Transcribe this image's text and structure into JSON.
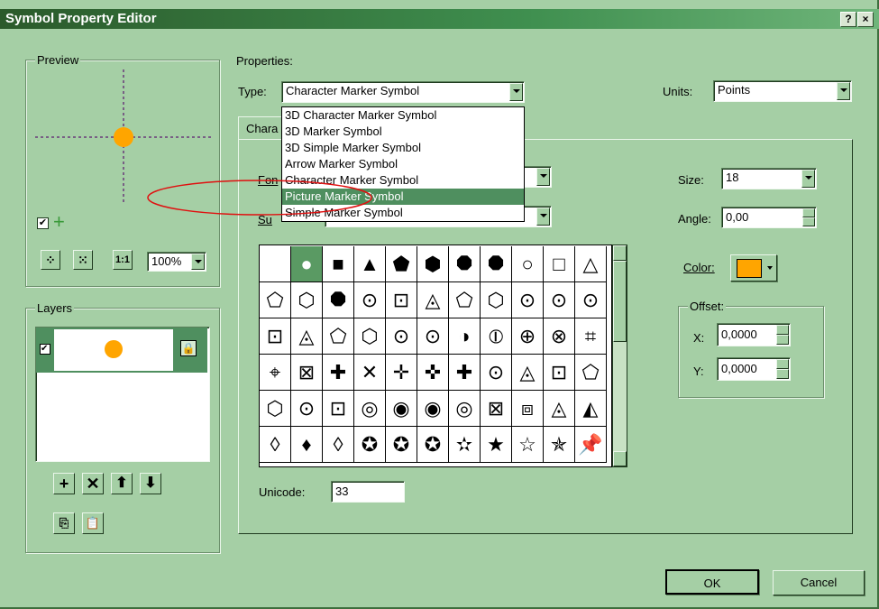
{
  "window": {
    "title": "Symbol Property Editor",
    "help_label": "?",
    "close_label": "×"
  },
  "preview": {
    "label": "Preview",
    "zoom_value": "100%",
    "marker_color": "#FFA500"
  },
  "layers": {
    "label": "Layers"
  },
  "properties": {
    "label": "Properties:",
    "type_label": "Type:",
    "type_value": "Character Marker Symbol",
    "units_label": "Units:",
    "units_value": "Points",
    "tab_label": "Chara",
    "font_label": "Fon",
    "subset_label": "Su",
    "type_options": [
      "3D Character Marker Symbol",
      "3D Marker Symbol",
      "3D Simple Marker Symbol",
      "Arrow Marker Symbol",
      "Character Marker Symbol",
      "Picture Marker Symbol",
      "Simple Marker Symbol"
    ],
    "highlighted_option": "Picture Marker Symbol",
    "size_label": "Size:",
    "size_value": "18",
    "angle_label": "Angle:",
    "angle_value": "0,00",
    "color_label": "Color:",
    "color_value": "#FFA500",
    "offset_label": "Offset:",
    "x_label": "X:",
    "x_value": "0,0000",
    "y_label": "Y:",
    "y_value": "0,0000",
    "unicode_label": "Unicode:",
    "unicode_value": "33",
    "glyphs": [
      [
        "",
        "●",
        "■",
        "▲",
        "⬟",
        "⬢",
        "⯃",
        "⯃",
        "○",
        "□",
        "△"
      ],
      [
        "⬠",
        "⬡",
        "⯃",
        "⊙",
        "⊡",
        "◬",
        "⬠",
        "⬡",
        "⊙",
        "⊙",
        "⊙"
      ],
      [
        "⊡",
        "◬",
        "⬠",
        "⬡",
        "⊙",
        "⊙",
        "◑",
        "⦶",
        "⊕",
        "⊗",
        "⌗"
      ],
      [
        "⌖",
        "⊠",
        "✚",
        "✕",
        "✛",
        "✜",
        "✚",
        "⊙",
        "◬",
        "⊡",
        "⬠"
      ],
      [
        "⬡",
        "⊙",
        "⊡",
        "◎",
        "◉",
        "◉",
        "◎",
        "⊠",
        "⧈",
        "◬",
        "◭"
      ],
      [
        "◊",
        "♦",
        "◊",
        "✪",
        "✪",
        "✪",
        "✫",
        "★",
        "☆",
        "✯",
        "📌"
      ]
    ],
    "selected_glyph_index": "1"
  },
  "buttons": {
    "ok": "OK",
    "cancel": "Cancel"
  }
}
